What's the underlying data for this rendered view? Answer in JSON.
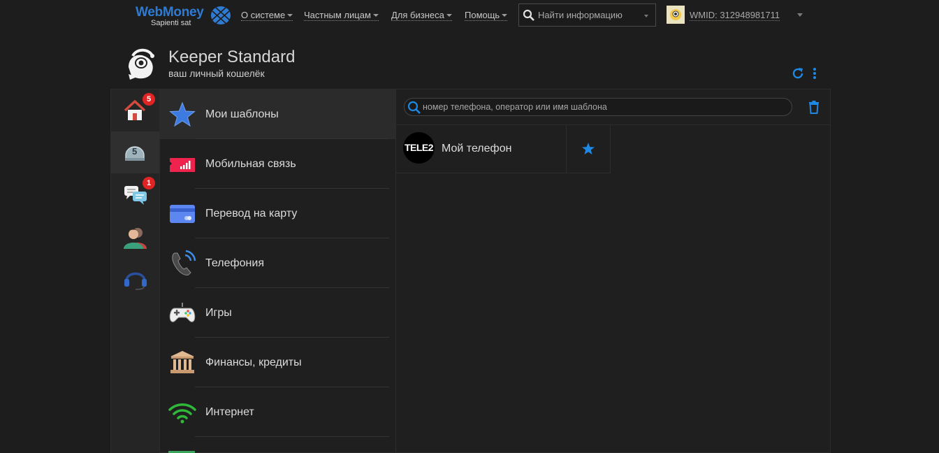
{
  "topbar": {
    "logo_title": "WebMoney",
    "logo_sub": "Sapienti sat",
    "nav": [
      "О системе",
      "Частным лицам",
      "Для бизнеса",
      "Помощь"
    ],
    "search_placeholder": "Найти информацию",
    "wmid": "WMID: 312948981711"
  },
  "keeper": {
    "title": "Keeper Standard",
    "subtitle": "ваш личный кошелёк"
  },
  "rail": {
    "home_badge": "5",
    "bank_value": "5",
    "messages_badge": "1"
  },
  "categories": [
    {
      "label": "Мои шаблоны",
      "icon": "star-icon"
    },
    {
      "label": "Мобильная связь",
      "icon": "mobile-signal-icon"
    },
    {
      "label": "Перевод на карту",
      "icon": "bank-card-icon"
    },
    {
      "label": "Телефония",
      "icon": "phone-icon"
    },
    {
      "label": "Игры",
      "icon": "gamepad-icon"
    },
    {
      "label": "Финансы, кредиты",
      "icon": "bank-building-icon"
    },
    {
      "label": "Интернет",
      "icon": "wifi-icon"
    }
  ],
  "templates": {
    "search_placeholder": "номер телефона, оператор или имя шаблона",
    "items": [
      {
        "operator": "TELE2",
        "name": "Мой телефон"
      }
    ]
  },
  "colors": {
    "accent": "#1e88e5",
    "badge": "#e02424",
    "background": "#1d1d1d"
  }
}
